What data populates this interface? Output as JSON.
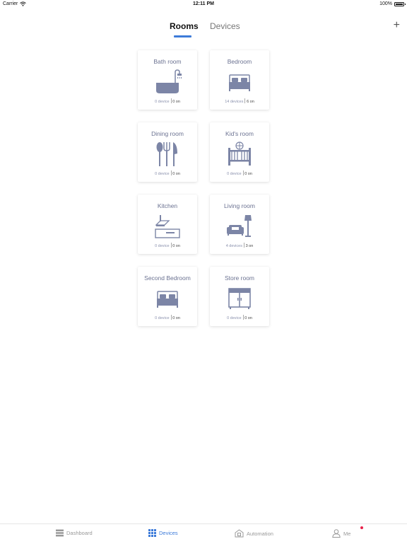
{
  "status": {
    "carrier": "Carrier",
    "time": "12:11 PM",
    "battery": "100%"
  },
  "header": {
    "tabs": [
      "Rooms",
      "Devices"
    ],
    "active_tab": "Rooms",
    "add_label": "+"
  },
  "rooms": [
    {
      "name": "Bath room",
      "devices": "0 device",
      "on": "0 on",
      "icon": "bathtub-icon"
    },
    {
      "name": "Bedroom",
      "devices": "14 devices",
      "on": "6 on",
      "icon": "bed-icon"
    },
    {
      "name": "Dining room",
      "devices": "0 device",
      "on": "0 on",
      "icon": "cutlery-icon"
    },
    {
      "name": "Kid's room",
      "devices": "0 device",
      "on": "0 on",
      "icon": "crib-icon"
    },
    {
      "name": "Kitchen",
      "devices": "0 device",
      "on": "0 on",
      "icon": "range-hood-icon"
    },
    {
      "name": "Living room",
      "devices": "4 devices",
      "on": "3 on",
      "icon": "sofa-lamp-icon"
    },
    {
      "name": "Second Bedroom",
      "devices": "0 device",
      "on": "0 on",
      "icon": "bed-icon"
    },
    {
      "name": "Store room",
      "devices": "0 device",
      "on": "0 on",
      "icon": "cabinet-icon"
    }
  ],
  "bottom_nav": [
    {
      "label": "Dashboard",
      "icon": "dashboard-icon"
    },
    {
      "label": "Devices",
      "icon": "devices-grid-icon"
    },
    {
      "label": "Automation",
      "icon": "home-automation-icon"
    },
    {
      "label": "Me",
      "icon": "user-icon"
    }
  ],
  "colors": {
    "accent": "#3d7bd9",
    "icon": "#7c85a6",
    "badge": "#e8224a"
  }
}
